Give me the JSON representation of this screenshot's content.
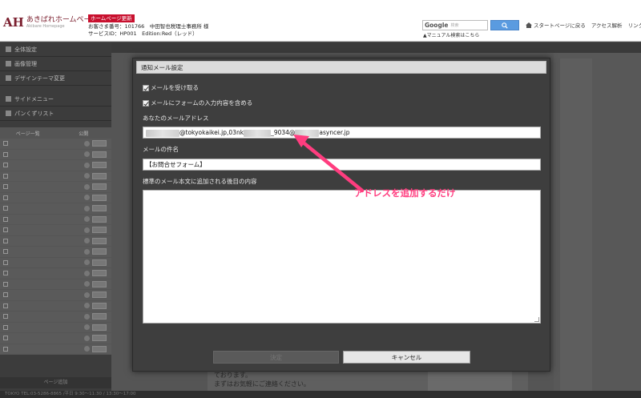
{
  "header": {
    "logo_mark": "AH",
    "logo_name": "あきばれホームページ",
    "logo_sub": "Akibare Homepage",
    "badge": "ホームページ更新",
    "account_line1": "お客さま番号：101766　中田智也税理士事務所 様",
    "account_line2": "サービスID：HP001　Edition:Red（レッド）",
    "search_brand": "Google",
    "search_placeholder": "検索",
    "manual_link": "▲マニュアル検索はこちら",
    "links": [
      "スタートページに戻る",
      "アクセス解析",
      "リンクサポー"
    ]
  },
  "sidebar": {
    "menu": [
      "全体設定",
      "画像管理",
      "デザインテーマ変更"
    ],
    "menu2": [
      "サイドメニュー",
      "パンくずリスト"
    ],
    "page_col_labels": [
      "ページ一覧",
      "公開"
    ],
    "footer": "ページ追加"
  },
  "main": {
    "preview_line1": "ております。",
    "preview_line2": "まずはお気軽にご連絡ください。",
    "status": "TOKYO TEL:03-5286-8865 /平日 9:30〜11:30 / 13:30〜17:00"
  },
  "modal": {
    "title": "通知メール設定",
    "receive_mail": "メールを受け取る",
    "include_form": "メールにフォームの入力内容を含める",
    "email_label": "あなたのメールアドレス",
    "email_part1": "@tokyokaikei.jp,03nk",
    "email_part2": "_9034@",
    "email_part3": "asyncer.jp",
    "subject_label": "メールの件名",
    "subject_value": "【お問合せフォーム】",
    "body_label": "標準のメール本文に追加される後目の内容",
    "ok_button": "決定",
    "cancel_button": "キャンセル"
  },
  "annotation": {
    "text": "アドレスを追加するだけ",
    "color": "#ff3d7f"
  },
  "colors": {
    "brand": "#7a1e2d",
    "badge": "#c8102e",
    "search_button": "#5a9be0"
  }
}
